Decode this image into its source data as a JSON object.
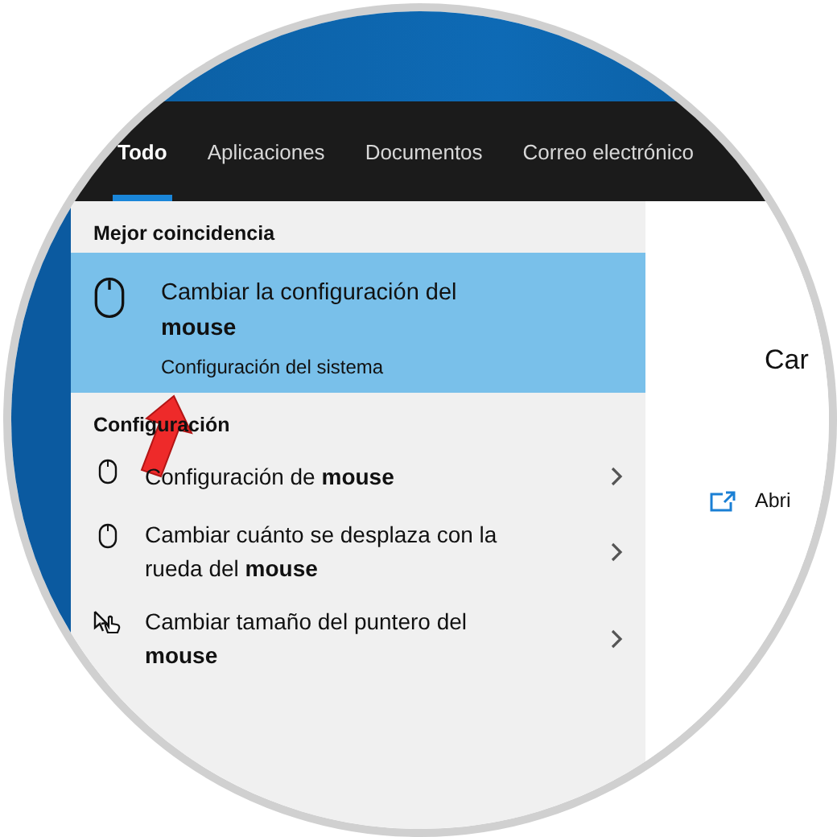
{
  "tabs": [
    {
      "label": "Todo",
      "selected": true
    },
    {
      "label": "Aplicaciones",
      "selected": false
    },
    {
      "label": "Documentos",
      "selected": false
    },
    {
      "label": "Correo electrónico",
      "selected": false
    }
  ],
  "best_match": {
    "heading": "Mejor coincidencia",
    "title": "Cambiar la configuración del **mouse**",
    "subtitle": "Configuración del sistema",
    "selected": true
  },
  "section": {
    "heading": "Configuración",
    "items": [
      {
        "kind": "mouse",
        "label": "Configuración de **mouse**"
      },
      {
        "kind": "mouse",
        "label": "Cambiar cuánto se desplaza con la rueda del **mouse**"
      },
      {
        "kind": "pointer",
        "label": "Cambiar tamaño del puntero del **mouse**"
      }
    ]
  },
  "preview": {
    "title": "Car",
    "action": "Abri"
  }
}
